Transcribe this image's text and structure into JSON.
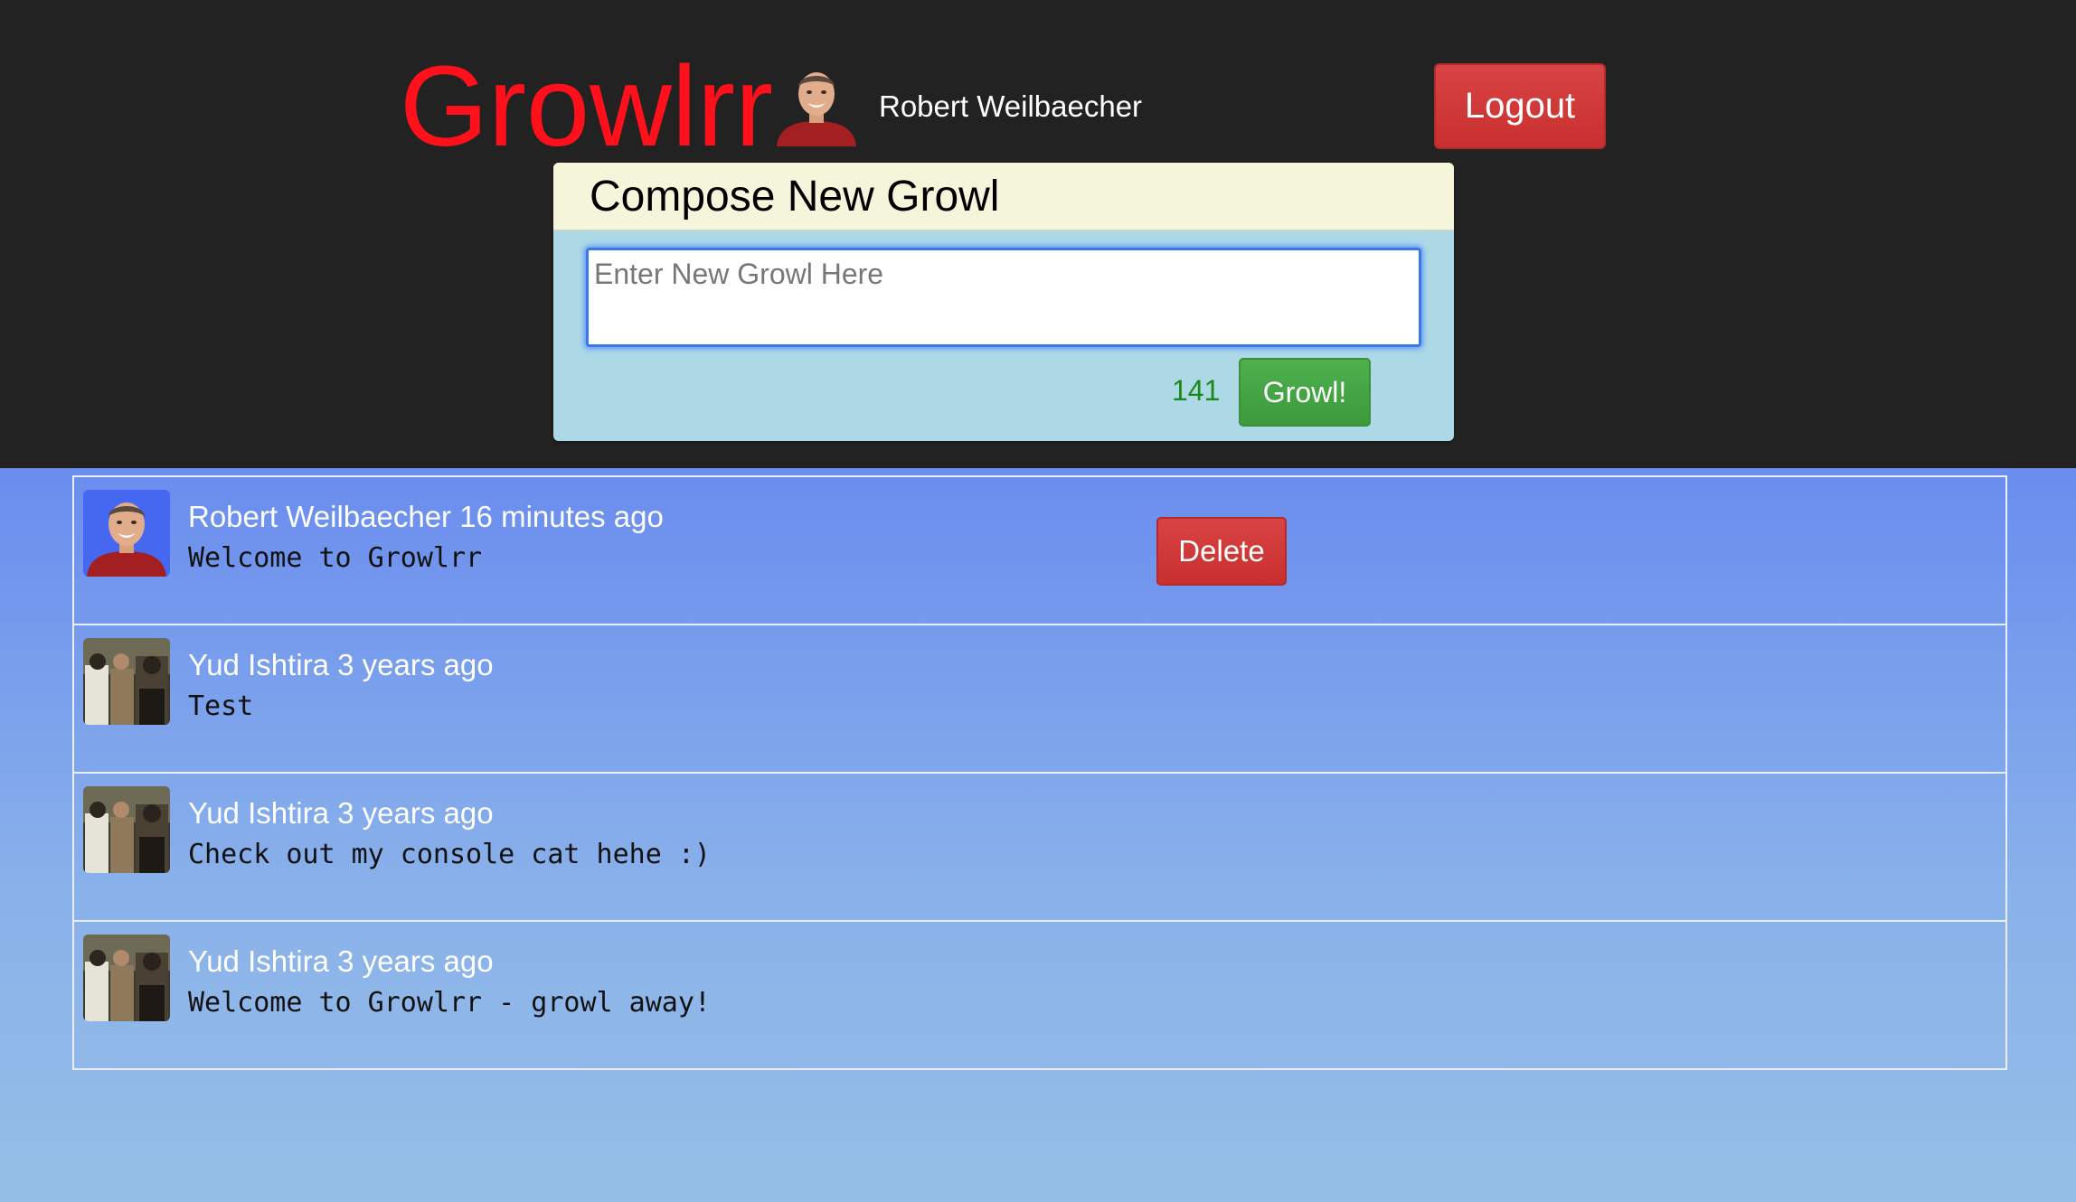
{
  "header": {
    "brand": "Growlrr",
    "username": "Robert Weilbaecher",
    "logout_label": "Logout",
    "avatar_icon": "user-avatar-icon"
  },
  "composer": {
    "title": "Compose New Growl",
    "placeholder": "Enter New Growl Here",
    "value": "",
    "char_count": "141",
    "submit_label": "Growl!"
  },
  "feed": {
    "items": [
      {
        "author": "Robert Weilbaecher",
        "time": "16 minutes ago",
        "meta": "Robert Weilbaecher 16 minutes ago",
        "text": "Welcome to Growlrr",
        "avatar": "user-avatar-icon",
        "delete_label": "Delete"
      },
      {
        "author": "Yud Ishtira",
        "time": "3 years ago",
        "meta": "Yud Ishtira 3 years ago",
        "text": "Test",
        "avatar": "photo-avatar-icon"
      },
      {
        "author": "Yud Ishtira",
        "time": "3 years ago",
        "meta": "Yud Ishtira 3 years ago",
        "text": "Check out my console cat hehe :)",
        "avatar": "photo-avatar-icon"
      },
      {
        "author": "Yud Ishtira",
        "time": "3 years ago",
        "meta": "Yud Ishtira 3 years ago",
        "text": "Welcome to Growlrr - growl away!",
        "avatar": "photo-avatar-icon"
      }
    ]
  },
  "colors": {
    "header_bg": "#222222",
    "brand": "#ff101a",
    "composer_head": "#f5f5dc",
    "composer_body": "#add8e6",
    "growl_button": "#3d9a3d",
    "danger_button": "#c8302f",
    "char_count": "#1a8a1a",
    "feed_gradient_top": "#4264f2",
    "feed_gradient_bottom": "#95bee6"
  }
}
